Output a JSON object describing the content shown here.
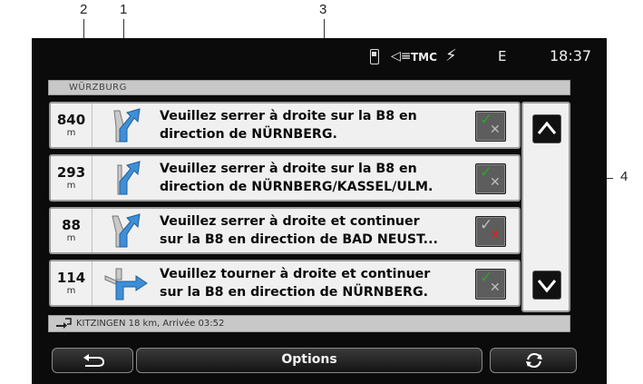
{
  "callouts": [
    "2",
    "1",
    "3",
    "4"
  ],
  "status": {
    "phone_icon": "phone-icon",
    "sound_icon": "sound-icon",
    "tmc": "TMC",
    "gps_icon": "gps-icon",
    "e": "E",
    "time": "18:37"
  },
  "town": "WÜRZBURG",
  "rows": [
    {
      "distance": "840",
      "unit": "m",
      "line1": "Veuillez serrer à droite sur la B8 en",
      "line2": "direction de NÜRNBERG.",
      "arrow_icon": "keep-right-arrow-icon",
      "check_status": "accepted"
    },
    {
      "distance": "293",
      "unit": "m",
      "line1": "Veuillez serrer à droite sur la B8 en",
      "line2": "direction de NÜRNBERG/KASSEL/ULM.",
      "arrow_icon": "keep-right-arrow-icon",
      "check_status": "accepted"
    },
    {
      "distance": "88",
      "unit": "m",
      "line1": "Veuillez serrer à droite et continuer",
      "line2": "sur la B8 en direction de BAD NEUST...",
      "arrow_icon": "keep-right-arrow-icon",
      "check_status": "rejected"
    },
    {
      "distance": "114",
      "unit": "m",
      "line1": "Veuillez tourner à droite et continuer",
      "line2": "sur la B8 en direction de NÜRNBERG.",
      "arrow_icon": "turn-right-arrow-icon",
      "check_status": "accepted"
    }
  ],
  "destination": "KITZINGEN 18 km, Arrivée 03:52",
  "bottom": {
    "back_icon": "back-icon",
    "options_label": "Options",
    "refresh_icon": "refresh-icon"
  },
  "colors": {
    "road_blue": "#3f8fd6",
    "check_green": "#2fa12f",
    "cross_red": "#e02020"
  }
}
